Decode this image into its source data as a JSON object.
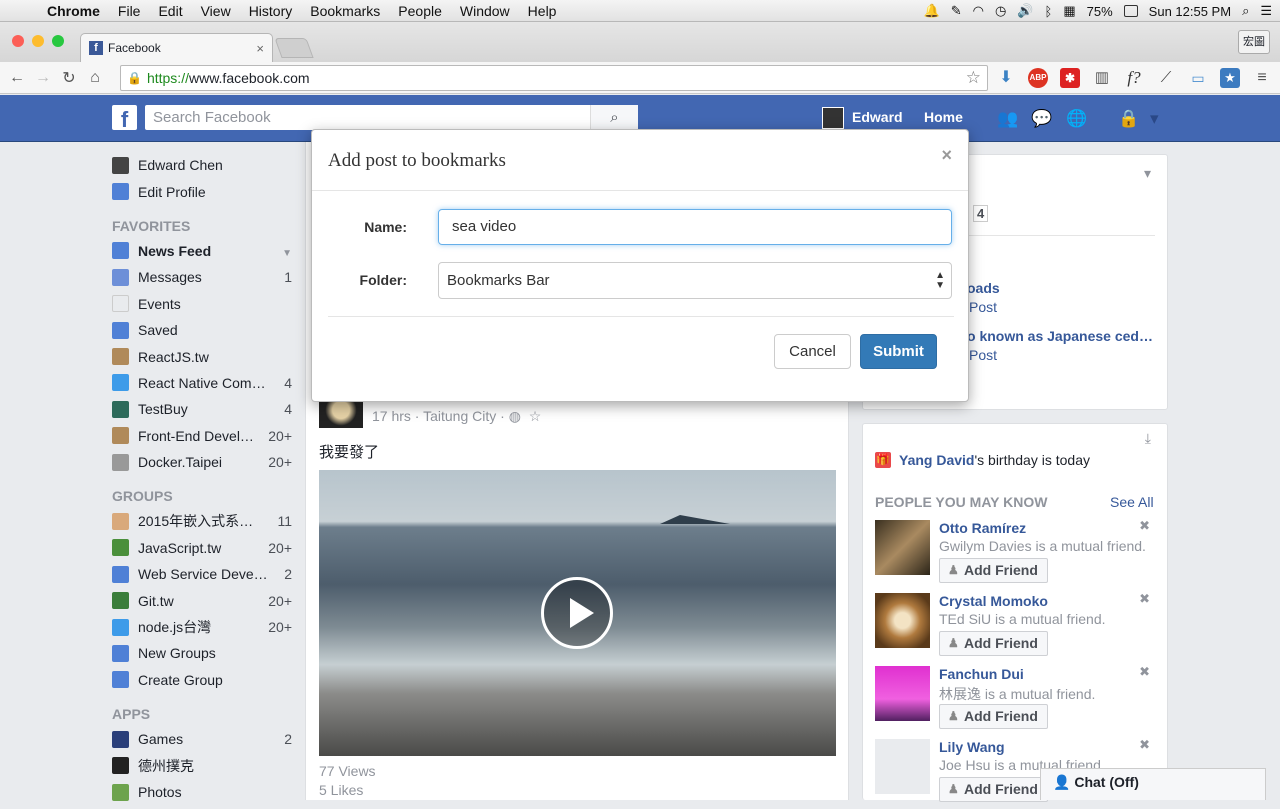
{
  "menubar": {
    "app": "Chrome",
    "items": [
      "File",
      "Edit",
      "View",
      "History",
      "Bookmarks",
      "People",
      "Window",
      "Help"
    ],
    "battery": "75%",
    "clock": "Sun 12:55 PM"
  },
  "browser": {
    "tab_title": "Facebook",
    "profile_label": "宏圖",
    "url_scheme": "https://",
    "url_rest": "www.facebook.com"
  },
  "header": {
    "search_placeholder": "Search Facebook",
    "user_name": "Edward",
    "home_label": "Home"
  },
  "sidebar": {
    "profile": "Edward Chen",
    "edit_profile": "Edit Profile",
    "favorites_title": "FAVORITES",
    "favorites": [
      {
        "label": "News Feed",
        "count": ""
      },
      {
        "label": "Messages",
        "count": "1"
      },
      {
        "label": "Events",
        "count": ""
      },
      {
        "label": "Saved",
        "count": ""
      },
      {
        "label": "ReactJS.tw",
        "count": ""
      },
      {
        "label": "React Native Com…",
        "count": "4"
      },
      {
        "label": "TestBuy",
        "count": "4"
      },
      {
        "label": "Front-End Devel…",
        "count": "20+"
      },
      {
        "label": "Docker.Taipei",
        "count": "20+"
      }
    ],
    "groups_title": "GROUPS",
    "groups": [
      {
        "label": "2015年嵌入式系…",
        "count": "11"
      },
      {
        "label": "JavaScript.tw",
        "count": "20+"
      },
      {
        "label": "Web Service Deve…",
        "count": "2"
      },
      {
        "label": "Git.tw",
        "count": "20+"
      },
      {
        "label": "node.js台灣",
        "count": "20+"
      },
      {
        "label": "New Groups",
        "count": ""
      },
      {
        "label": "Create Group",
        "count": ""
      }
    ],
    "apps_title": "APPS",
    "apps": [
      {
        "label": "Games",
        "count": "2"
      },
      {
        "label": "德州撲克",
        "count": ""
      },
      {
        "label": "Photos",
        "count": ""
      }
    ]
  },
  "post": {
    "meta": "17 hrs · Taitung City · ",
    "text": "我要發了",
    "views": "77 Views",
    "likes": "5 Likes"
  },
  "right": {
    "count_badge": "4",
    "link1": "oads",
    "post1": "Post",
    "link2": "o known as Japanese ced…",
    "post2": "Post",
    "birthday_name": "Yang David",
    "birthday_text": "'s birthday is today",
    "pymk_title": "PEOPLE YOU MAY KNOW",
    "see_all": "See All",
    "add_friend": "Add Friend",
    "people": [
      {
        "name": "Otto Ramírez",
        "mutual": "Gwilym Davies is a mutual friend."
      },
      {
        "name": "Crystal Momoko",
        "mutual": "TEd SiU is a mutual friend."
      },
      {
        "name": "Fanchun Dui",
        "mutual": "林展逸 is a mutual friend."
      },
      {
        "name": "Lily Wang",
        "mutual": "Joe Hsu is a mutual friend."
      }
    ]
  },
  "chat": {
    "label": "Chat (Off)"
  },
  "dialog": {
    "title": "Add post to bookmarks",
    "close": "×",
    "name_label": "Name:",
    "name_value": "sea video",
    "folder_label": "Folder:",
    "folder_value": "Bookmarks Bar",
    "cancel": "Cancel",
    "submit": "Submit"
  }
}
